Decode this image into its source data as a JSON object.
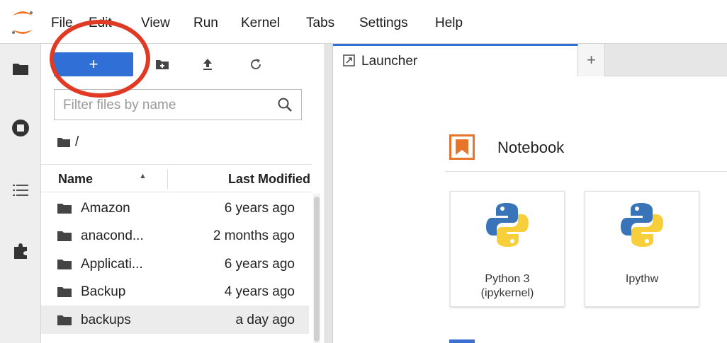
{
  "menu": [
    "File",
    "Edit",
    "View",
    "Run",
    "Kernel",
    "Tabs",
    "Settings",
    "Help"
  ],
  "toolbar": {
    "new_label": "+"
  },
  "filter": {
    "placeholder": "Filter files by name"
  },
  "breadcrumb": "/",
  "columns": {
    "name": "Name",
    "modified": "Last Modified"
  },
  "files": [
    {
      "name": "Amazon",
      "modified": "6 years ago"
    },
    {
      "name": "anacond...",
      "modified": "2 months ago"
    },
    {
      "name": "Applicati...",
      "modified": "6 years ago"
    },
    {
      "name": "Backup",
      "modified": "4 years ago"
    },
    {
      "name": "backups",
      "modified": "a day ago"
    }
  ],
  "tab": {
    "label": "Launcher",
    "add_label": "+"
  },
  "launcher": {
    "section_title": "Notebook",
    "kernels": [
      {
        "line1": "Python 3",
        "line2": "(ipykernel)"
      },
      {
        "line1": "Ipythw",
        "line2": ""
      }
    ]
  },
  "colors": {
    "accent": "#2f6fd6",
    "notebook_icon": "#e8742c",
    "annotation": "#e03a24"
  },
  "icons": [
    "jupyter-logo",
    "folder-icon",
    "running-icon",
    "toc-icon",
    "extension-icon",
    "new-folder-icon",
    "upload-icon",
    "refresh-icon",
    "search-icon",
    "launcher-icon",
    "python-logo"
  ]
}
